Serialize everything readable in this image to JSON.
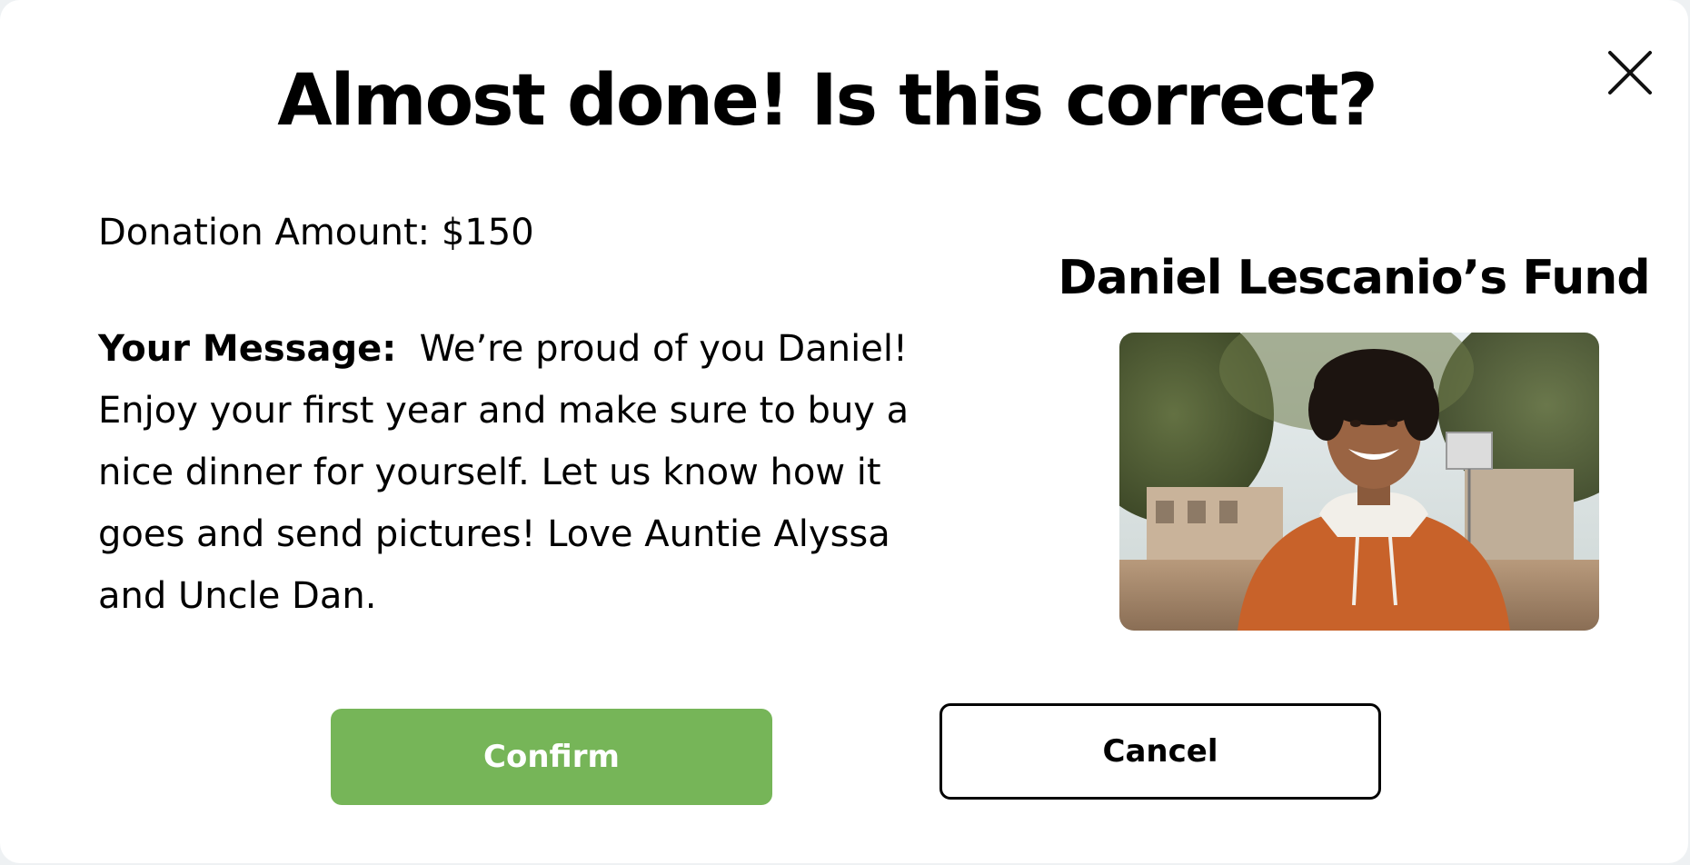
{
  "dialog": {
    "title": "Almost done! Is this correct?",
    "close_icon": "close-icon"
  },
  "donation": {
    "label": "Donation Amount:",
    "value": "$150"
  },
  "message": {
    "label": "Your Message:",
    "text": "We’re proud of you Daniel! Enjoy your first year and make sure to buy a nice dinner for yourself. Let us know how it goes and send pictures! Love Auntie Alyssa and Uncle Dan."
  },
  "fund": {
    "name": "Daniel Lescanio’s Fund"
  },
  "actions": {
    "confirm_label": "Confirm",
    "cancel_label": "Cancel"
  },
  "colors": {
    "confirm_bg": "#76b558",
    "confirm_text": "#ffffff",
    "cancel_border": "#000000"
  }
}
